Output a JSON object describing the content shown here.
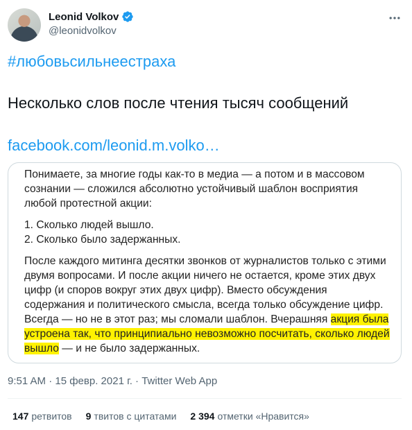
{
  "author": {
    "name": "Leonid Volkov",
    "handle": "@leonidvolkov",
    "verified_color": "#1d9bf0"
  },
  "tweet": {
    "hashtag": "#любовьсильнеестраха",
    "text": "Несколько слов после чтения тысяч сообщений",
    "link": "facebook.com/leonid.m.volko…"
  },
  "card": {
    "paragraph1": "Понимаете, за многие годы как-то в медиа — а потом и в массовом сознании — сложился абсолютно устойчивый шаблон восприятия любой протестной акции:",
    "item1": "1. Сколько людей вышло.",
    "item2": "2. Сколько было задержанных.",
    "paragraph2_plain": "После каждого митинга десятки звонков от журналистов только с этими двумя вопросами. И после акции ничего не остается, кроме этих двух цифр (и споров вокруг этих двух цифр). Вместо обсуждения содержания и политического смысла, всегда только обсуждение цифр. Всегда — но не в этот раз; мы сломали шаблон. Вчерашняя ",
    "paragraph2_highlight": "акция была устроена так, что принципиально невозможно посчитать, сколько людей вышло",
    "paragraph2_end": " — и не было задержанных.",
    "highlight_color": "#fff200"
  },
  "meta": {
    "timestamp": "9:51 AM · 15 февр. 2021 г. · Twitter Web App"
  },
  "stats": {
    "retweets_count": "147",
    "retweets_label": "ретвитов",
    "quotes_count": "9",
    "quotes_label": "твитов с цитатами",
    "likes_count": "2 394",
    "likes_label": "отметки «Нравится»"
  }
}
